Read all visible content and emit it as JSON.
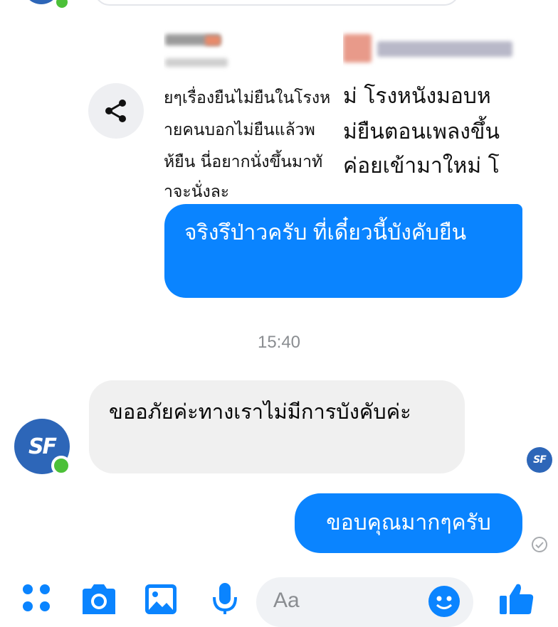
{
  "colors": {
    "accent": "#0a84ff",
    "incoming_bg": "#f0f0f0",
    "avatar_blue": "#2d66b8",
    "online_green": "#4cc038",
    "muted_text": "#8a8d91"
  },
  "shared_images": {
    "left_lines": [
      "ยๆเรื่องยืนไม่ยืนในโรงห",
      "ายคนบอกไม่ยืนแล้วพ",
      "ห้ยืน นี่อยากนั่งขึ้นมาทั",
      "าจะนั่งละ"
    ],
    "right_lines": [
      "ม่ โรงหนังมอบห",
      "ม่ยืนตอนเพลงขึ้น",
      "ค่อยเข้ามาใหม่ โ"
    ]
  },
  "messages": {
    "outgoing_1": "จริงรึป่าวครับ ที่เดี๋ยวนี้บังคับยืน",
    "timestamp": "15:40",
    "incoming_1": "ขออภัยค่ะทางเราไม่มีการบังคับค่ะ",
    "outgoing_2": "ขอบคุณมากๆครับ"
  },
  "avatar": {
    "label": "SF"
  },
  "composer": {
    "placeholder": "Aa"
  },
  "icons": {
    "share": "share-icon",
    "menu": "four-dots-icon",
    "camera": "camera-icon",
    "gallery": "image-icon",
    "mic": "microphone-icon",
    "emoji": "emoji-icon",
    "like": "thumbs-up-icon",
    "seen": "check-circle-icon"
  }
}
